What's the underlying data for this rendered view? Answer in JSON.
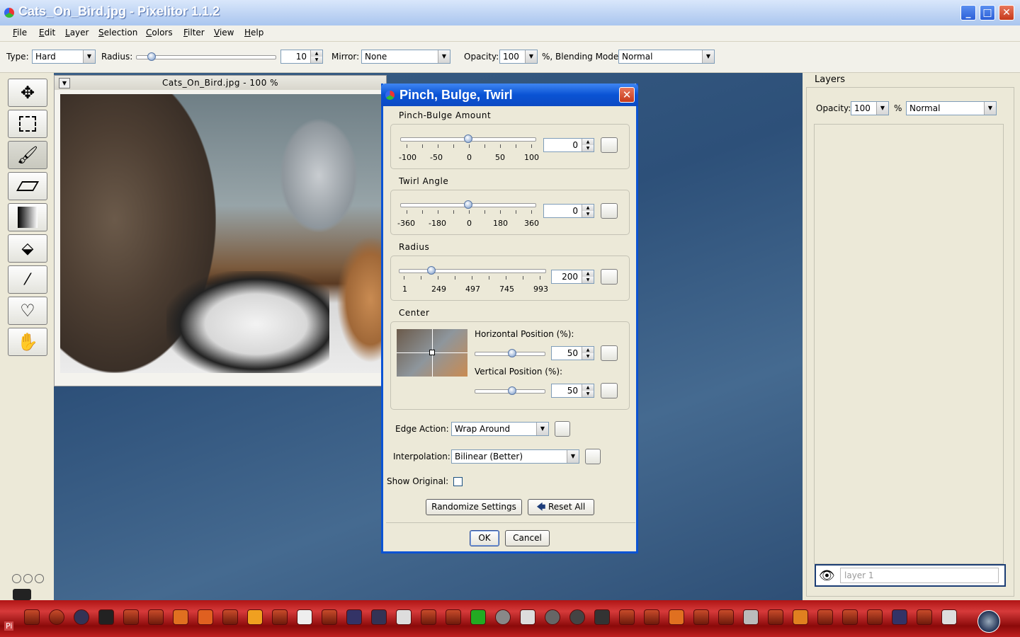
{
  "window": {
    "title": "Cats_On_Bird.jpg - Pixelitor 1.1.2"
  },
  "menubar": [
    "File",
    "Edit",
    "Layer",
    "Selection",
    "Colors",
    "Filter",
    "View",
    "Help"
  ],
  "toolbar": {
    "type_label": "Type:",
    "type_value": "Hard",
    "radius_label": "Radius:",
    "radius_value": "10",
    "mirror_label": "Mirror:",
    "mirror_value": "None",
    "opacity_label": "Opacity:",
    "opacity_value": "100",
    "blending_label": "%, Blending Mode:",
    "blending_value": "Normal"
  },
  "tools": [
    "move-tool-icon",
    "selection-tool-icon",
    "brush-tool-icon",
    "eraser-tool-icon",
    "gradient-tool-icon",
    "paint-bucket-icon",
    "color-picker-icon",
    "shape-heart-icon",
    "hand-tool-icon"
  ],
  "image_window": {
    "title": "Cats_On_Bird.jpg - 100 %"
  },
  "layers_panel": {
    "title": "Layers",
    "opacity_label": "Opacity:",
    "opacity_value": "100",
    "percent": "%",
    "blend_value": "Normal",
    "layer_name": "layer 1"
  },
  "dialog": {
    "title": "Pinch, Bulge, Twirl",
    "pinch": {
      "label": "Pinch-Bulge Amount",
      "value": "0",
      "ticks": [
        "-100",
        "-50",
        "0",
        "50",
        "100"
      ]
    },
    "twirl": {
      "label": "Twirl Angle",
      "value": "0",
      "ticks": [
        "-360",
        "-180",
        "0",
        "180",
        "360"
      ]
    },
    "radius": {
      "label": "Radius",
      "value": "200",
      "ticks": [
        "1",
        "249",
        "497",
        "745",
        "993"
      ]
    },
    "center": {
      "label": "Center",
      "h_label": "Horizontal Position (%):",
      "h_value": "50",
      "v_label": "Vertical Position (%):",
      "v_value": "50"
    },
    "edge_label": "Edge Action:",
    "edge_value": "Wrap Around",
    "interp_label": "Interpolation:",
    "interp_value": "Bilinear (Better)",
    "show_original": "Show Original:",
    "randomize": "Randomize Settings",
    "reset": "Reset All",
    "ok": "OK",
    "cancel": "Cancel"
  },
  "taskbar": {
    "start_text": "Pi"
  }
}
